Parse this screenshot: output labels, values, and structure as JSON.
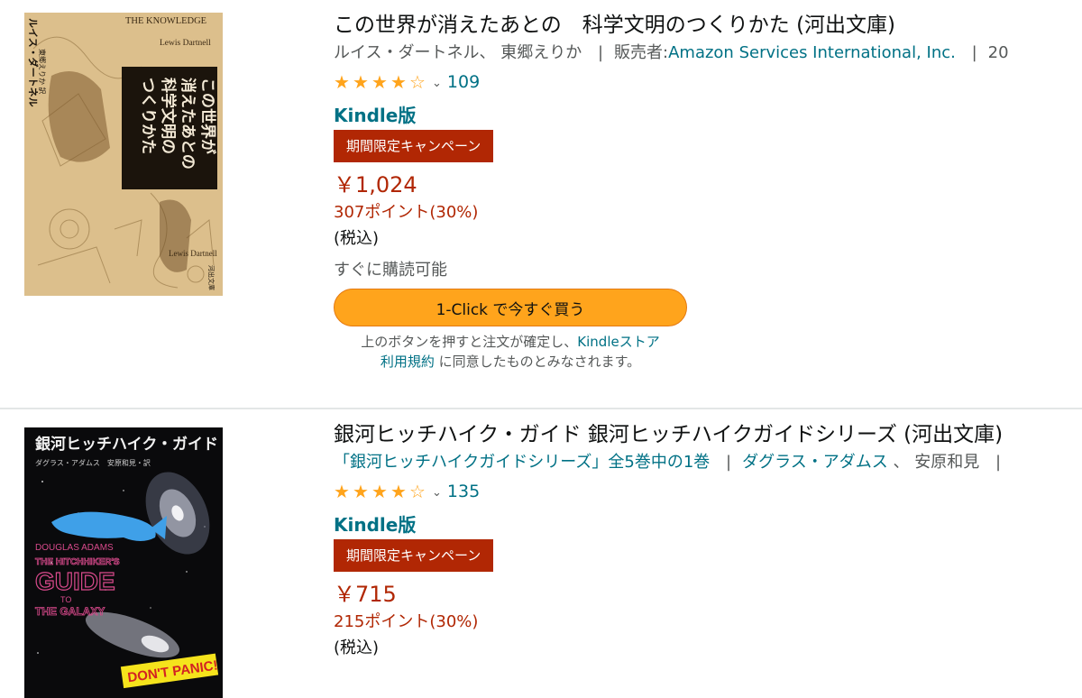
{
  "results": [
    {
      "cover": {
        "title_en": "THE KNOWLEDGE",
        "author_en": "Lewis Dartnell",
        "title_jp_lines": [
          "この世界が",
          "消えたあとの",
          "科学文明の",
          "つくりかた"
        ],
        "author_jp": "ルイス・ダートネル",
        "translator_jp": "東郷えりか 訳",
        "publisher_jp": "河出文庫"
      },
      "title": "この世界が消えたあとの　科学文明のつくりかた (河出文庫)",
      "meta": {
        "author1": "ルイス・ダートネル",
        "comma1": "、",
        "author2": "東郷えりか",
        "seller_prefix": "販売者:",
        "seller": "Amazon Services International, Inc.",
        "trailing": "20"
      },
      "rating": {
        "stars": 4,
        "count": "109"
      },
      "format": "Kindle版",
      "badge": "期間限定キャンペーン",
      "price": "￥1,024",
      "points": "307ポイント(30%)",
      "tax": "(税込)",
      "availability": "すぐに購読可能",
      "buy_button": "1-Click で今すぐ買う",
      "legal": {
        "part1": "上のボタンを押すと注文が確定し、",
        "link1": "Kindleストア",
        "link2": "利用規約",
        "part2": " に同意したものとみなされます。"
      }
    },
    {
      "cover": {
        "title_jp": "銀河ヒッチハイク・ガイド",
        "authors_jp": "ダグラス・アダムス　安原和見・訳",
        "author_en": "DOUGLAS ADAMS",
        "title_en1": "THE HITCHHIKER'S",
        "title_en2": "GUIDE",
        "title_en3": "TO",
        "title_en4": "THE GALAXY",
        "slogan": "DON'T PANIC!"
      },
      "title": "銀河ヒッチハイク・ガイド 銀河ヒッチハイクガイドシリーズ (河出文庫)",
      "meta": {
        "series": "「銀河ヒッチハイクガイドシリーズ」全5巻中の1巻",
        "author1": "ダグラス・アダムス",
        "comma1": " 、",
        "author2": "安原和見"
      },
      "rating": {
        "stars": 4,
        "count": "135"
      },
      "format": "Kindle版",
      "badge": "期間限定キャンペーン",
      "price": "￥715",
      "points": "215ポイント(30%)",
      "tax": "(税込)"
    }
  ],
  "colors": {
    "link": "#007185",
    "price": "#b12704",
    "badge_bg": "#b12704",
    "star": "#ffa41c",
    "buy_button": "#ffa41c"
  }
}
